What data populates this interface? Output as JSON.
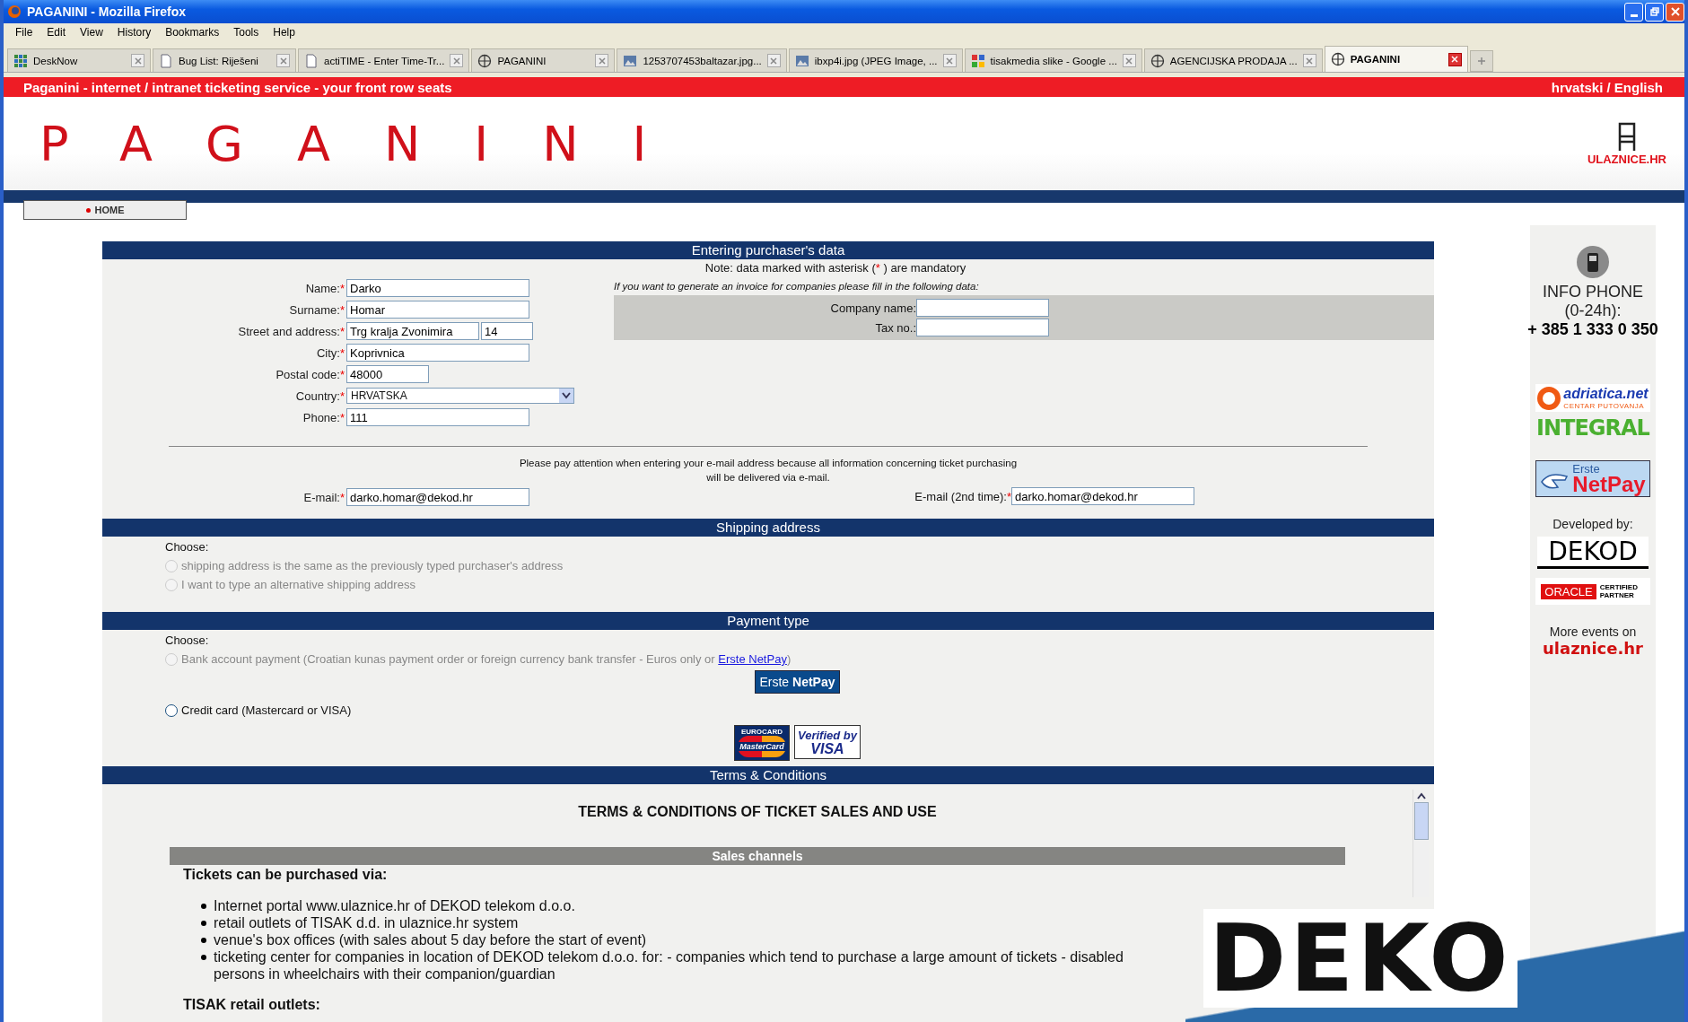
{
  "window": {
    "title": "PAGANINI - Mozilla Firefox"
  },
  "menu": [
    "File",
    "Edit",
    "View",
    "History",
    "Bookmarks",
    "Tools",
    "Help"
  ],
  "tabs": [
    {
      "label": "DeskNow",
      "kind": "grid",
      "selected": false
    },
    {
      "label": "Bug List: Riješeni",
      "kind": "page",
      "selected": false
    },
    {
      "label": "actiTIME - Enter Time-Tr...",
      "kind": "page",
      "selected": false
    },
    {
      "label": "PAGANINI",
      "kind": "globe",
      "selected": false
    },
    {
      "label": "1253707453baltazar.jpg...",
      "kind": "image",
      "selected": false
    },
    {
      "label": "ibxp4i.jpg (JPEG Image, ...",
      "kind": "image",
      "selected": false
    },
    {
      "label": "tisakmedia slike - Google ...",
      "kind": "google",
      "selected": false
    },
    {
      "label": "AGENCIJSKA PRODAJA ...",
      "kind": "globe",
      "selected": false
    },
    {
      "label": "PAGANINI",
      "kind": "globe",
      "selected": true
    }
  ],
  "banner": {
    "tagline": "Paganini - internet / intranet ticketing service - your front row seats",
    "language": "hrvatski / English"
  },
  "header": {
    "logo": "PAGANINI",
    "partner_logo": "ULAZNICE.HR"
  },
  "nav": [
    {
      "label": "HOME"
    }
  ],
  "purchaser": {
    "title": "Entering purchaser's data",
    "note": {
      "before": "Note: data marked with asterisk (",
      "mark": "*",
      "after": " ) are mandatory"
    },
    "fields": [
      {
        "label": "Name:",
        "required": true,
        "kind": "text",
        "value": "Darko"
      },
      {
        "label": "Surname:",
        "required": true,
        "kind": "text",
        "value": "Homar"
      },
      {
        "label": "Street and address:",
        "required": true,
        "kind": "pair",
        "value": "Trg kralja Zvonimira",
        "value_2": "14"
      },
      {
        "label": "City:",
        "required": true,
        "kind": "text",
        "value": "Koprivnica"
      },
      {
        "label": "Postal code:",
        "required": true,
        "kind": "short",
        "value": "48000"
      },
      {
        "label": "Country:",
        "required": true,
        "kind": "select",
        "value": "HRVATSKA"
      },
      {
        "label": "Phone:",
        "required": true,
        "kind": "text",
        "value": "111"
      }
    ],
    "invoice": {
      "hint": "If you want to generate an invoice for companies please fill in the following data:",
      "fields": [
        {
          "label": "Company name:"
        },
        {
          "label": "Tax no.:"
        }
      ]
    },
    "email_note": [
      "Please pay attention when entering your e-mail address because all information concerning ticket purchasing",
      "will be delivered via e-mail."
    ],
    "email": {
      "label": "E-mail:",
      "required": true,
      "value": "darko.homar@dekod.hr"
    },
    "email_repeat": {
      "label": "E-mail (2nd time):",
      "required": true,
      "value": "darko.homar@dekod.hr"
    }
  },
  "shipping": {
    "title": "Shipping address",
    "choose": "Choose:",
    "options": [
      {
        "label": "shipping address is the same as the previously typed purchaser's address",
        "selected": false,
        "disabled": true
      },
      {
        "label": "I want to type an alternative shipping address",
        "selected": false,
        "disabled": true
      }
    ]
  },
  "payment": {
    "title": "Payment type",
    "choose": "Choose:",
    "options": [
      {
        "label": "Bank account payment (Croatian kunas payment order or foreign currency bank transfer - Euros only or ",
        "link": "Erste NetPay",
        "after": ")",
        "selected": false,
        "disabled": true,
        "button": {
          "before": "Erste ",
          "bold": "NetPay"
        }
      },
      {
        "label": "Credit card (Mastercard or VISA)",
        "selected": false,
        "disabled": false,
        "cards": {
          "mastercard": [
            "EUROCARD",
            "MasterCard"
          ],
          "visa": [
            "Verified by",
            "VISA"
          ]
        }
      }
    ]
  },
  "terms": {
    "title": "Terms & Conditions",
    "heading": "TERMS & CONDITIONS OF TICKET SALES AND USE",
    "section": "Sales channels",
    "intro": "Tickets can be purchased via:",
    "items": [
      "Internet portal www.ulaznice.hr of DEKOD telekom d.o.o.",
      "retail outlets of TISAK d.d. in ulaznice.hr system",
      "venue's box offices (with sales about 5 day before the start of event)",
      "ticketing center for companies in location of DEKOD telekom d.o.o. for: - companies which tend to purchase a large amount of tickets - disabled persons in wheelchairs with their companion/guardian"
    ],
    "next_heading": "TISAK retail outlets:"
  },
  "sidebar": {
    "info_title": "INFO PHONE",
    "info_hours": "(0-24h):",
    "phone": "+ 385 1 333 0 350",
    "adriatica": "adriatica.net",
    "adriatica_sub": "CENTAR PUTOVANJA",
    "integral": "INTEGRAL",
    "netpay_top": "Erste",
    "netpay_bottom": "NetPay",
    "developed": "Developed by:",
    "dekod": "DEKOD",
    "oracle": "ORACLE",
    "oracle_sub": "CERTIFIED PARTNER",
    "more": "More events on",
    "more_link": "ulaznice.hr"
  },
  "overlay": {
    "text": "DEKO"
  }
}
